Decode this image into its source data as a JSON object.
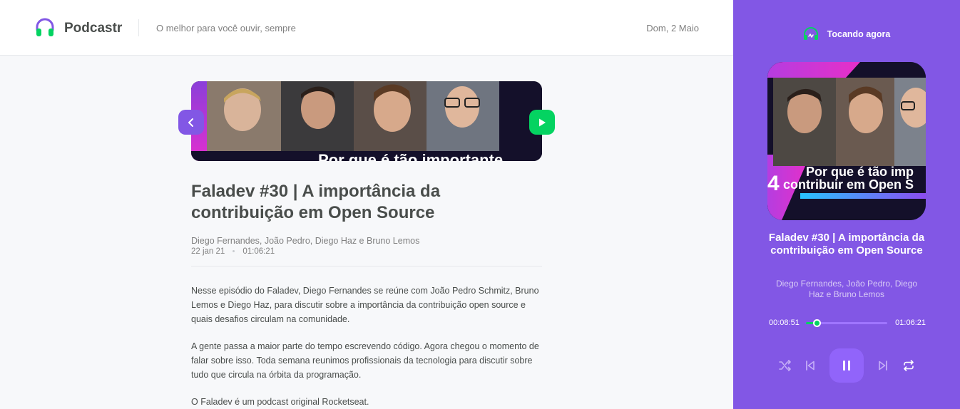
{
  "app": {
    "name": "Podcastr",
    "tagline": "O melhor para você ouvir, sempre",
    "date": "Dom, 2 Maio"
  },
  "episode": {
    "title": "Faladev #30 | A importância da contribuição em Open Source",
    "members": "Diego Fernandes, João Pedro, Diego Haz e Bruno Lemos",
    "published_at": "22 jan 21",
    "duration": "01:06:21",
    "thumbnail_caption": "Por que é tão importante",
    "description": [
      "Nesse episódio do Faladev, Diego Fernandes se reúne com João Pedro Schmitz, Bruno Lemos e Diego Haz, para discutir sobre a importância da contribuição open source e quais desafios circulam na comunidade.",
      "A gente passa a maior parte do tempo escrevendo código. Agora chegou o momento de falar sobre isso. Toda semana reunimos profissionais da tecnologia para discutir sobre tudo que circula na órbita da programação.",
      "O Faladev é um podcast original Rocketseat."
    ]
  },
  "player": {
    "label": "Tocando agora",
    "cover_caption_line1": "Por que é tão imp",
    "cover_caption_line2": "contribuir em Open S",
    "cover_number": "4",
    "title": "Faladev #30 | A importância da contribuição em Open Source",
    "members": "Diego Fernandes, João Pedro, Diego Haz e Bruno Lemos",
    "current_time": "00:08:51",
    "duration": "01:06:21",
    "progress": 0.133,
    "state": "playing"
  },
  "icons": {
    "logo": "headphones-icon",
    "back": "chevron-left-icon",
    "play": "play-icon",
    "now_playing": "playing-icon",
    "shuffle": "shuffle-icon",
    "previous": "skip-previous-icon",
    "pause": "pause-icon",
    "next": "skip-next-icon",
    "repeat": "repeat-icon"
  },
  "colors": {
    "accent": "#8257e5",
    "green": "#04d361",
    "text": "#494d4b",
    "muted": "#808080"
  }
}
